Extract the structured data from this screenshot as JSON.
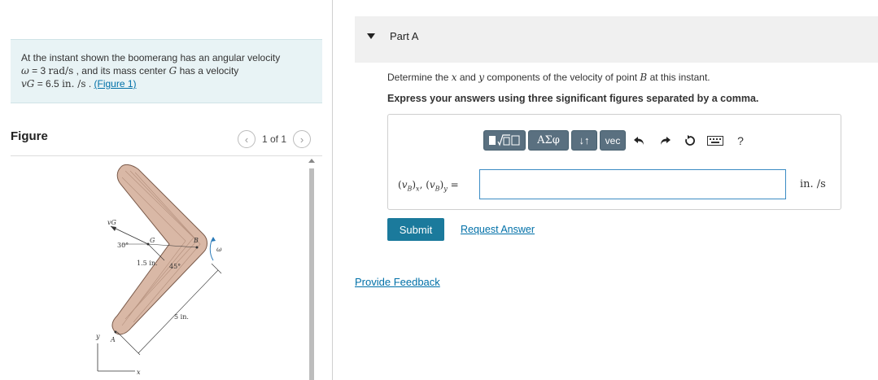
{
  "problem": {
    "intro": "At the instant shown the boomerang has an angular velocity",
    "omega_symbol": "ω",
    "omega_eq": " = 3 ",
    "omega_unit": "rad/s",
    "mid_text": " , and its mass center ",
    "g_symbol": "G",
    "mid_text2": " has a velocity",
    "vg_symbol": "vG",
    "vg_eq": " = 6.5 ",
    "vg_unit": "in. /s",
    "end_text": " . ",
    "figure_link": "(Figure 1)"
  },
  "figure_panel": {
    "label": "Figure",
    "pager_text": "1 of 1",
    "prev_icon": "chevron-left-icon",
    "next_icon": "chevron-right-icon"
  },
  "figure_labels": {
    "vg": "vG",
    "angle30": "30°",
    "g": "G",
    "b": "B",
    "omega": "ω",
    "dist15": "1.5 in.",
    "angle45": "45°",
    "dist5": "5 in.",
    "a": "A",
    "y": "y",
    "x": "x"
  },
  "part": {
    "title": "Part A",
    "question_prefix": "Determine the ",
    "x_sym": "x",
    "and": " and ",
    "y_sym": "y",
    "question_suffix": " components of the velocity of point ",
    "b_sym": "B",
    "question_end": " at this instant.",
    "instruction": "Express your answers using three significant figures separated by a comma."
  },
  "toolbar": {
    "templates_icon": "templates-icon",
    "greek_label": "ΑΣφ",
    "arrows_label": "↓↑",
    "vec_label": "vec",
    "undo_icon": "undo-icon",
    "redo_icon": "redo-icon",
    "reset_icon": "reset-icon",
    "keyboard_icon": "keyboard-icon",
    "help_label": "?"
  },
  "answer": {
    "expression_label": "(vB)x, (vB)y =",
    "input_value": "",
    "unit": "in. /s"
  },
  "actions": {
    "submit_label": "Submit",
    "request_answer_label": "Request Answer",
    "feedback_label": "Provide Feedback"
  },
  "colors": {
    "problem_bg": "#e8f3f5",
    "part_header_bg": "#f0f0f0",
    "submit_bg": "#1b7a9c",
    "link": "#0070a8",
    "toolbar_btn": "#5a7080",
    "boomerang": "#d9b8a6"
  }
}
